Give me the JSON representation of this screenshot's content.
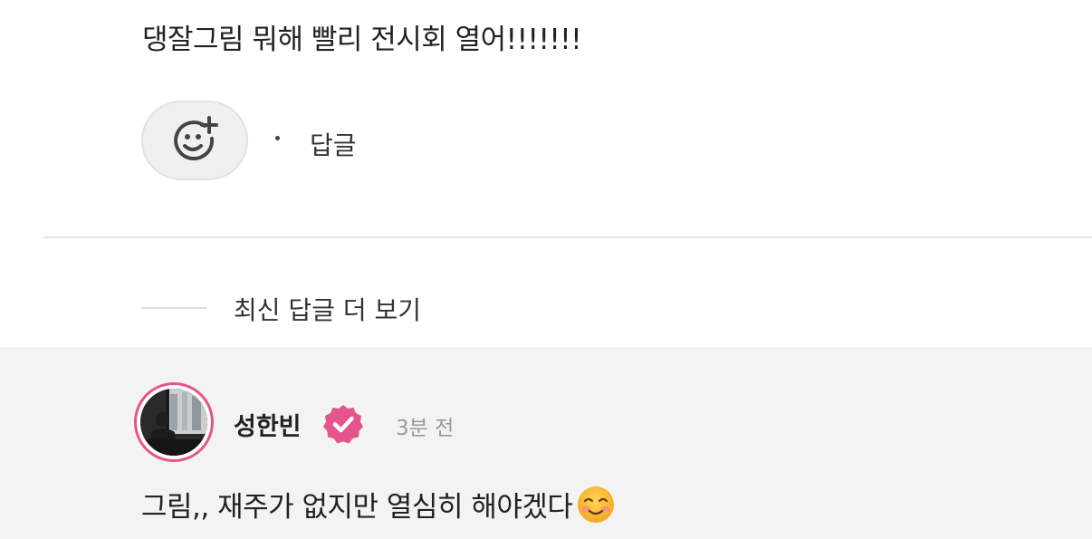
{
  "comment": {
    "text": "댕잘그림 뭐해 빨리 전시회 열어!!!!!!!",
    "reply_label": "답글",
    "emoji_reaction_icon": "smile-plus-icon"
  },
  "more_replies": {
    "label": "최신 답글 더 보기"
  },
  "reply": {
    "username": "성한빈",
    "verified_icon": "verified-badge-icon",
    "timestamp": "3분 전",
    "text": "그림,, 재주가 없지만 열심히 해야겠다",
    "emoji": "smiling-face-icon"
  },
  "colors": {
    "accent": "#e5548a",
    "muted": "#999999",
    "reply_background": "#f3f3f3"
  }
}
